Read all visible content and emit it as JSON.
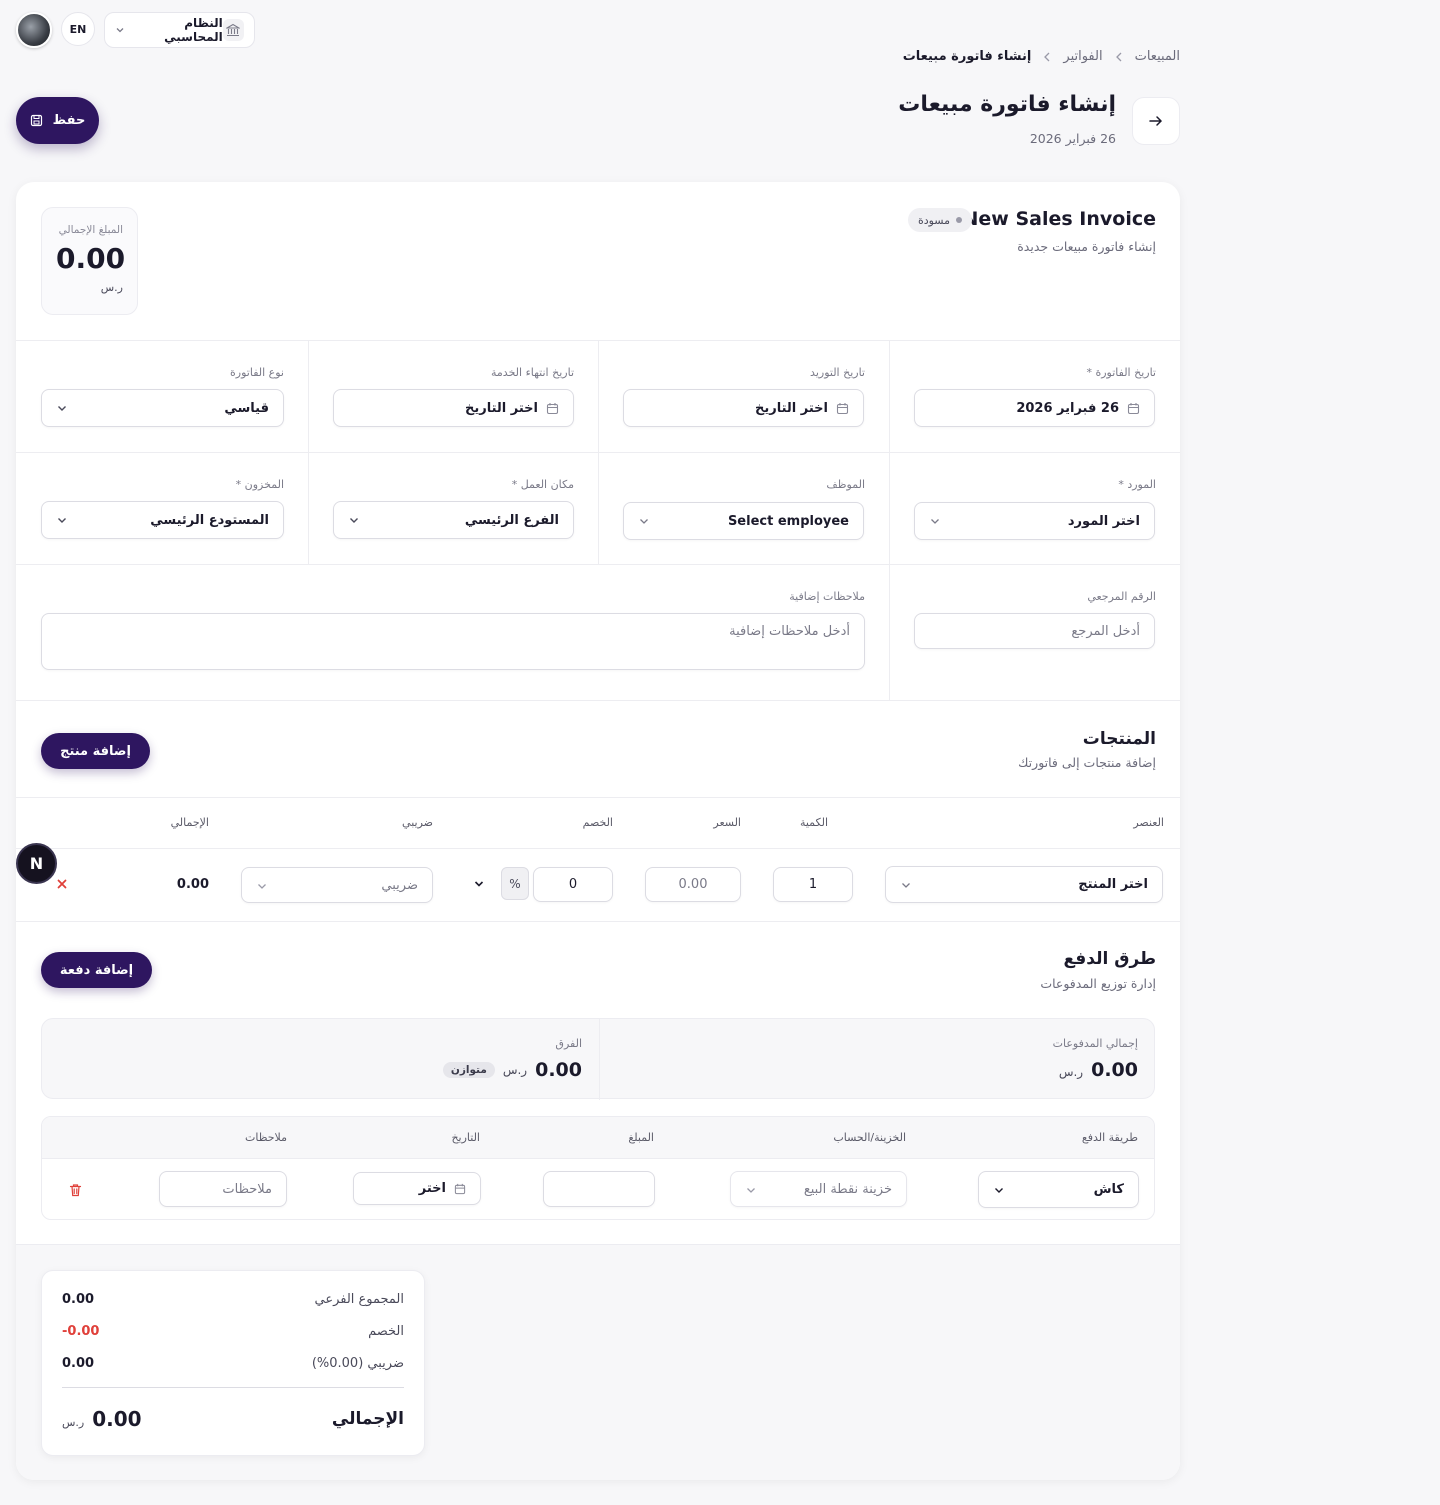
{
  "topbar": {
    "lang": "EN",
    "system_label": "النظام المحاسبي"
  },
  "breadcrumb": [
    "المبيعات",
    "الفواتير",
    "إنشاء فاتورة مبيعات"
  ],
  "header": {
    "title": "إنشاء فاتورة مبيعات",
    "date": "26 فبراير 2026",
    "save_label": "حفظ"
  },
  "invoice": {
    "title": "New Sales Invoice",
    "subtitle": "إنشاء فاتورة مبيعات جديدة",
    "status": "مسودة",
    "total_label": "المبلغ الإجمالي",
    "total_value": "0.00",
    "currency": "ر.س"
  },
  "fields": {
    "invoice_date": {
      "label": "تاريخ الفاتورة *",
      "value": "26 فبراير 2026"
    },
    "supply_date": {
      "label": "تاريخ التوريد",
      "placeholder": "اختر التاريخ"
    },
    "service_end_date": {
      "label": "تاريخ انتهاء الخدمة",
      "placeholder": "اختر التاريخ"
    },
    "invoice_type": {
      "label": "نوع الفاتورة",
      "value": "قياسي"
    },
    "supplier": {
      "label": "المورد *",
      "value": "اختر المورد"
    },
    "employee": {
      "label": "الموظف",
      "value": "Select employee"
    },
    "workplace": {
      "label": "مكان العمل *",
      "value": "الفرع الرئيسي"
    },
    "warehouse": {
      "label": "المخزون *",
      "value": "المستودع الرئيسي"
    },
    "reference": {
      "label": "الرقم المرجعي",
      "placeholder": "أدخل المرجع"
    },
    "notes": {
      "label": "ملاحظات إضافية",
      "placeholder": "أدخل ملاحظات إضافية"
    }
  },
  "products": {
    "title": "المنتجات",
    "subtitle": "إضافة منتجات إلى فاتورتك",
    "add_label": "إضافة منتج",
    "columns": [
      "العنصر",
      "الكمية",
      "السعر",
      "الخصم",
      "ضريبي",
      "الإجمالي"
    ],
    "row": {
      "item": "اختر المنتج",
      "qty": "1",
      "price": "0.00",
      "discount": "0",
      "discount_unit": "%",
      "tax": "ضريبي",
      "total": "0.00"
    }
  },
  "payments": {
    "title": "طرق الدفع",
    "subtitle": "إدارة توزيع المدفوعات",
    "add_label": "إضافة دفعة",
    "total_paid_label": "إجمالي المدفوعات",
    "total_paid": "0.00",
    "diff_label": "الفرق",
    "diff": "0.00",
    "balanced": "متوازن",
    "currency": "ر.س",
    "columns": [
      "طريقة الدفع",
      "الخزينة/الحساب",
      "المبلغ",
      "التاريخ",
      "ملاحظات"
    ],
    "row": {
      "method": "كاش",
      "account": "خزينة نقطة البيع",
      "amount": "",
      "date": "اختر",
      "notes": "ملاحظات"
    }
  },
  "summary": {
    "subtotal_label": "المجموع الفرعي",
    "subtotal": "0.00",
    "discount_label": "الخصم",
    "discount": "-0.00",
    "tax_label": "ضريبي (0.00%)",
    "tax": "0.00",
    "total_label": "الإجمالي",
    "total": "0.00",
    "currency": "ر.س"
  },
  "floating_badge": "N",
  "colors": {
    "primary": "#2e1660",
    "danger": "#e0403a"
  }
}
